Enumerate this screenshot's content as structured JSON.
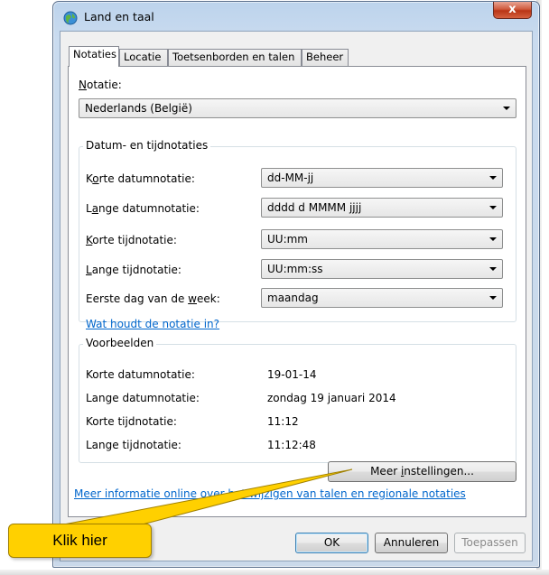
{
  "window": {
    "title": "Land en taal",
    "close_label": "x",
    "icon": "globe-icon"
  },
  "tabs": [
    {
      "label": "Notaties",
      "active": true
    },
    {
      "label": "Locatie",
      "active": false
    },
    {
      "label": "Toetsenborden en talen",
      "active": false
    },
    {
      "label": "Beheer",
      "active": false
    }
  ],
  "format": {
    "label_prefix": "",
    "label_u": "N",
    "label_rest": "otatie:",
    "value": "Nederlands (België)"
  },
  "datetime_group": {
    "title": "Datum- en tijdnotaties",
    "rows": [
      {
        "pre": "K",
        "u": "o",
        "post": "rte datumnotatie:",
        "value": "dd-MM-jj"
      },
      {
        "pre": "L",
        "u": "a",
        "post": "nge datumnotatie:",
        "value": "dddd d MMMM jjjj"
      },
      {
        "pre": "",
        "u": "K",
        "post": "orte tijdnotatie:",
        "value": "UU:mm"
      },
      {
        "pre": "",
        "u": "L",
        "post": "ange tijdnotatie:",
        "value": "UU:mm:ss"
      },
      {
        "pre": "Eerste dag van de ",
        "u": "w",
        "post": "eek:",
        "value": "maandag"
      }
    ],
    "help_link": "Wat houdt de notatie in?"
  },
  "examples_group": {
    "title": "Voorbeelden",
    "rows": [
      {
        "label": "Korte datumnotatie:",
        "value": "19-01-14"
      },
      {
        "label": "Lange datumnotatie:",
        "value": "zondag 19 januari 2014"
      },
      {
        "label": "Korte tijdnotatie:",
        "value": "11:12"
      },
      {
        "label": "Lange tijdnotatie:",
        "value": "11:12:48"
      }
    ]
  },
  "more_settings": {
    "pre": "Meer ",
    "u": "i",
    "post": "nstellingen..."
  },
  "info_link": "Meer informatie online over het wijzigen van talen en regionale notaties",
  "footer": {
    "ok": "OK",
    "cancel": "Annuleren",
    "apply": "Toepassen"
  },
  "callout": {
    "text": "Klik hier",
    "color": "#ffd000"
  }
}
